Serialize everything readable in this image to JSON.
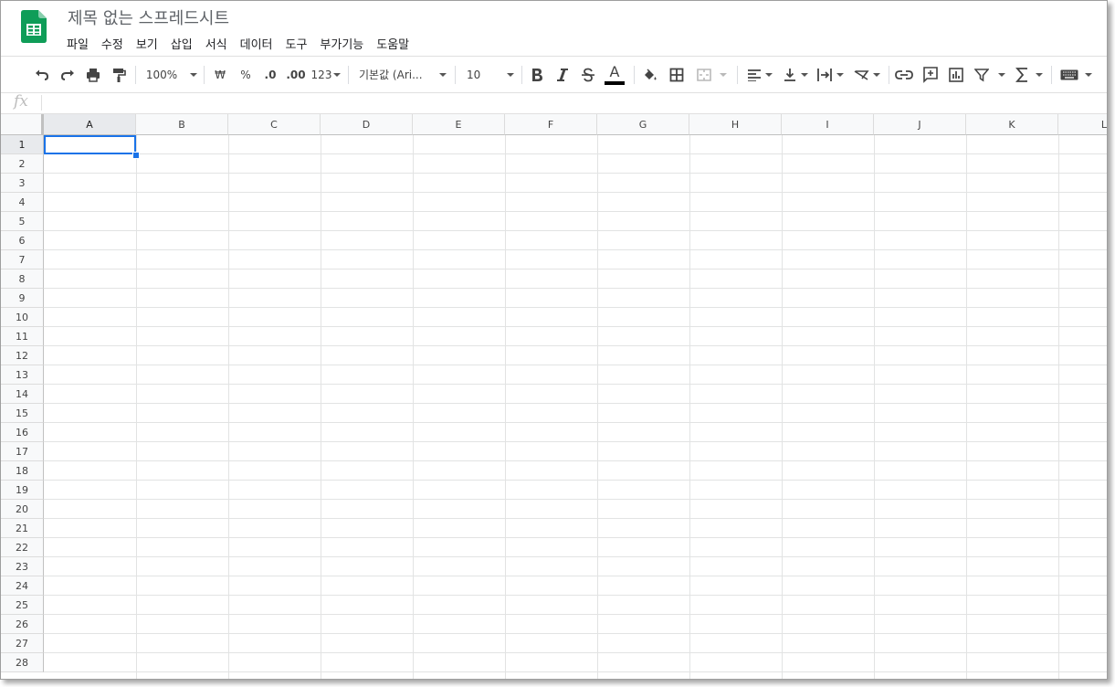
{
  "app": {
    "title": "제목 없는 스프레드시트",
    "logo_icon": "sheets-logo-icon",
    "accent_color": "#1a73e8",
    "logo_color": "#0f9d58"
  },
  "menu": [
    "파일",
    "수정",
    "보기",
    "삽입",
    "서식",
    "데이터",
    "도구",
    "부가기능",
    "도움말"
  ],
  "toolbar": {
    "zoom": "100%",
    "currency": "₩",
    "percent": "%",
    "decimal_decrease": ".0",
    "decimal_increase": ".00",
    "number_format": "123",
    "font": "기본값 (Ari...",
    "font_size": "10",
    "text_color_letter": "A",
    "icons": [
      "undo-icon",
      "redo-icon",
      "print-icon",
      "paint-format-icon",
      "bold-icon",
      "italic-icon",
      "strikethrough-icon",
      "text-color-icon",
      "fill-color-icon",
      "borders-icon",
      "merge-cells-icon",
      "horizontal-align-icon",
      "vertical-align-icon",
      "text-wrap-icon",
      "text-rotate-icon",
      "insert-link-icon",
      "insert-comment-icon",
      "insert-chart-icon",
      "filter-icon",
      "functions-icon",
      "input-tools-icon"
    ]
  },
  "formula_bar": {
    "label": "fx",
    "value": ""
  },
  "grid": {
    "columns": [
      "A",
      "B",
      "C",
      "D",
      "E",
      "F",
      "G",
      "H",
      "I",
      "J",
      "K",
      "L"
    ],
    "rows": [
      "1",
      "2",
      "3",
      "4",
      "5",
      "6",
      "7",
      "8",
      "9",
      "10",
      "11",
      "12",
      "13",
      "14",
      "15",
      "16",
      "17",
      "18",
      "19",
      "20",
      "21",
      "22",
      "23",
      "24",
      "25",
      "26",
      "27",
      "28"
    ],
    "selected_cell": "A1"
  }
}
